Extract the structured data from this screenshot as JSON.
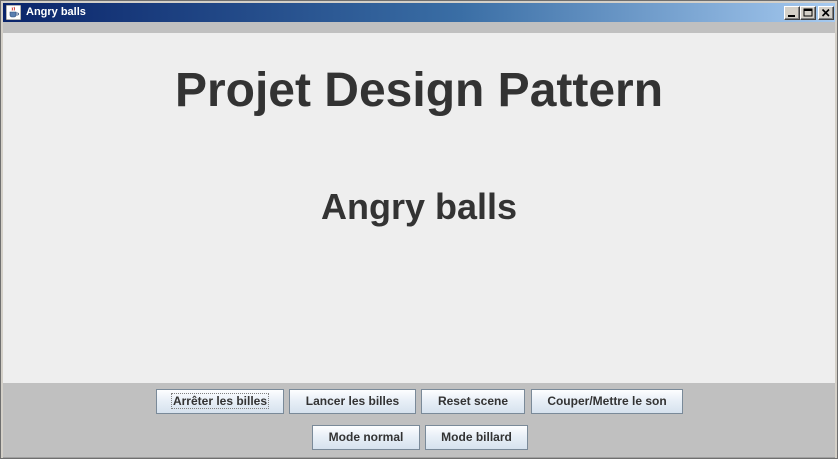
{
  "window": {
    "title": "Angry balls",
    "controls": {
      "minimize_icon": "minimize-icon",
      "maximize_icon": "maximize-icon",
      "close_icon": "close-icon"
    },
    "app_icon": "java-cup-icon"
  },
  "main": {
    "title": "Projet Design Pattern",
    "subtitle": "Angry balls"
  },
  "controls": {
    "row1": [
      {
        "label": "Arrêter les billes"
      },
      {
        "label": "Lancer les billes"
      },
      {
        "label": "Reset scene"
      },
      {
        "label": "Couper/Mettre le son"
      }
    ],
    "row2": [
      {
        "label": "Mode normal"
      },
      {
        "label": "Mode billard"
      }
    ]
  },
  "colors": {
    "titlebar_start": "#0a246a",
    "titlebar_end": "#a6caf0",
    "content_bg": "#eeeeee",
    "panel_bg": "#c0c0c0",
    "heading_text": "#333333"
  }
}
